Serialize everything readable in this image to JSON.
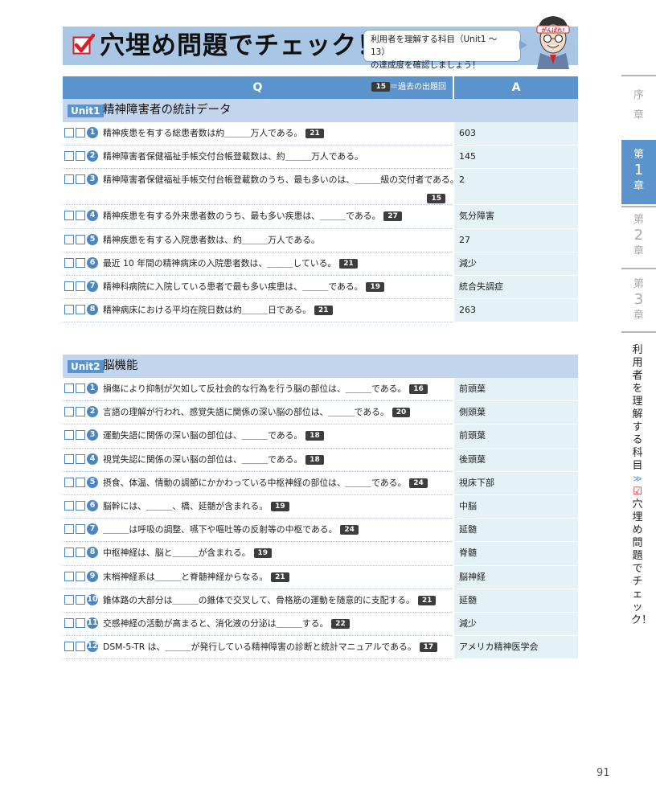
{
  "header": {
    "title": "穴埋め問題でチェック！",
    "bubble_line1": "利用者を理解する科目（Unit1 ～ 13）",
    "bubble_line2": "の達成度を確認しましょう！",
    "mascot_headband": "がんばれ!"
  },
  "table": {
    "q_label": "Q",
    "a_label": "A",
    "legend_badge": "15",
    "legend_text": "＝過去の出題回"
  },
  "units": [
    {
      "badge": "Unit1",
      "title": "精神障害者の統計データ",
      "rows": [
        {
          "num": "1",
          "q": "精神疾患を有する総患者数は約＿＿＿万人である。",
          "exam": "21",
          "a": "603"
        },
        {
          "num": "2",
          "q": "精神障害者保健福祉手帳交付台帳登載数は、約＿＿＿万人である。",
          "exam": "",
          "a": "145"
        },
        {
          "num": "3",
          "q": "精神障害者保健福祉手帳交付台帳登載数のうち、最も多いのは、＿＿＿級の交付者である。",
          "exam": "15",
          "a": "2"
        },
        {
          "num": "4",
          "q": "精神疾患を有する外来患者数のうち、最も多い疾患は、＿＿＿である。",
          "exam": "27",
          "a": "気分障害"
        },
        {
          "num": "5",
          "q": "精神疾患を有する入院患者数は、約＿＿＿万人である。",
          "exam": "",
          "a": "27"
        },
        {
          "num": "6",
          "q": "最近 10 年間の精神病床の入院患者数は、＿＿＿している。",
          "exam": "21",
          "a": "減少"
        },
        {
          "num": "7",
          "q": "精神科病院に入院している患者で最も多い疾患は、＿＿＿である。",
          "exam": "19",
          "a": "統合失調症"
        },
        {
          "num": "8",
          "q": "精神病床における平均在院日数は約＿＿＿日である。",
          "exam": "21",
          "a": "263"
        }
      ]
    },
    {
      "badge": "Unit2",
      "title": "脳機能",
      "rows": [
        {
          "num": "1",
          "q": "損傷により抑制が欠如して反社会的な行為を行う脳の部位は、＿＿＿である。",
          "exam": "16",
          "a": "前頭葉"
        },
        {
          "num": "2",
          "q": "言語の理解が行われ、感覚失語に関係の深い脳の部位は、＿＿＿である。",
          "exam": "20",
          "a": "側頭葉"
        },
        {
          "num": "3",
          "q": "運動失語に関係の深い脳の部位は、＿＿＿である。",
          "exam": "18",
          "a": "前頭葉"
        },
        {
          "num": "4",
          "q": "視覚失認に関係の深い脳の部位は、＿＿＿である。",
          "exam": "18",
          "a": "後頭葉"
        },
        {
          "num": "5",
          "q": "摂食、体温、情動の調節にかかわっている中枢神経の部位は、＿＿＿である。",
          "exam": "24",
          "a": "視床下部"
        },
        {
          "num": "6",
          "q": "脳幹には、＿＿＿、橋、延髄が含まれる。",
          "exam": "19",
          "a": "中脳"
        },
        {
          "num": "7",
          "q": "＿＿＿は呼吸の調整、嚥下や嘔吐等の反射等の中枢である。",
          "exam": "24",
          "a": "延髄"
        },
        {
          "num": "8",
          "q": "中枢神経は、脳と＿＿＿が含まれる。",
          "exam": "19",
          "a": "脊髄"
        },
        {
          "num": "9",
          "q": "末梢神経系は＿＿＿と脊髄神経からなる。",
          "exam": "21",
          "a": "脳神経"
        },
        {
          "num": "10",
          "q": "錐体路の大部分は＿＿＿の錐体で交叉して、骨格筋の運動を随意的に支配する。",
          "exam": "21",
          "a": "延髄"
        },
        {
          "num": "11",
          "q": "交感神経の活動が高まると、消化液の分泌は＿＿＿する。",
          "exam": "22",
          "a": "減少"
        },
        {
          "num": "12",
          "q": "DSM-5-TR は、＿＿＿が発行している精神障害の診断と統計マニュアルである。",
          "exam": "17",
          "a": "アメリカ精神医学会"
        }
      ]
    }
  ],
  "side_tabs": [
    {
      "top": "序",
      "big": "",
      "bottom": "章",
      "active": false
    },
    {
      "top": "第",
      "big": "1",
      "bottom": "章",
      "active": true
    },
    {
      "top": "第",
      "big": "2",
      "bottom": "章",
      "active": false
    },
    {
      "top": "第",
      "big": "3",
      "bottom": "章",
      "active": false
    }
  ],
  "side_text": {
    "part1": "利用者を理解する科目",
    "chevrons": "≫",
    "check": "☑",
    "part2": "穴埋め問題でチェック！"
  },
  "page_number": "91",
  "colors": {
    "banner": "#a9c7e5",
    "header_blue": "#5b93cc",
    "unit_row": "#c3d5ec",
    "answer_bg": "#e4f1f5",
    "check_red": "#d8202a"
  }
}
